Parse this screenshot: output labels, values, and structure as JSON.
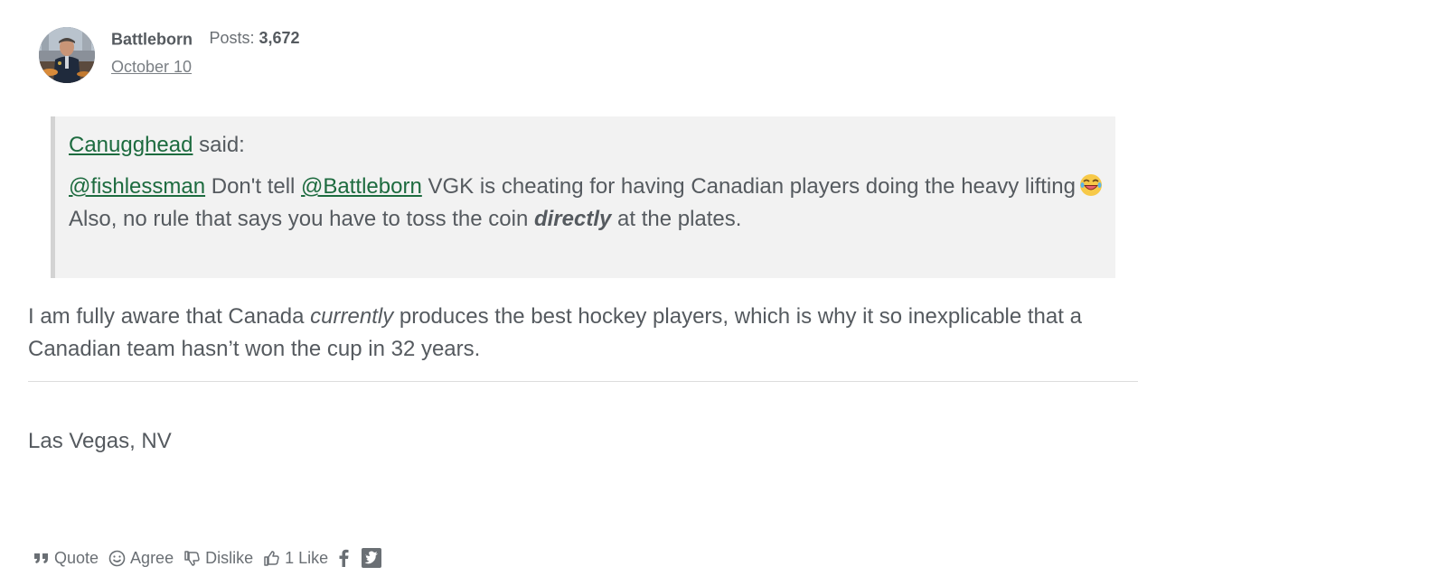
{
  "author": {
    "name": "Battleborn",
    "posts_label": "Posts:",
    "posts_count": "3,672",
    "date": "October 10"
  },
  "quote": {
    "source_user": "Canugghead",
    "said_label": " said:",
    "mention_1": "@fishlessman",
    "text_1": " Don't tell ",
    "mention_2": "@Battleborn",
    "text_2": " VGK is cheating for having Canadian players doing the heavy lifting",
    "emoji": "laughing-face-emoji",
    "text_3a": "Also, no rule that says you have to toss the coin ",
    "text_3_emph": "directly",
    "text_3b": " at the plates."
  },
  "body": {
    "part_1": "I am fully aware that Canada ",
    "emph": "currently",
    "part_2": " produces the best hockey players, which is why it so inexplicable that a Canadian team hasn’t won the cup in 32 years."
  },
  "signature": "Las Vegas, NV",
  "actions": {
    "quote_label": "Quote",
    "agree_label": "Agree",
    "dislike_label": "Dislike",
    "like_label": "1 Like",
    "icons": [
      "quote-icon",
      "smile-icon",
      "thumbs-down-icon",
      "thumbs-up-icon",
      "facebook-icon",
      "twitter-icon"
    ]
  },
  "colors": {
    "link": "#1d6b3f",
    "text": "#555a5f",
    "quote_bg": "#f2f2f2",
    "quote_border": "#d3d3d3"
  }
}
